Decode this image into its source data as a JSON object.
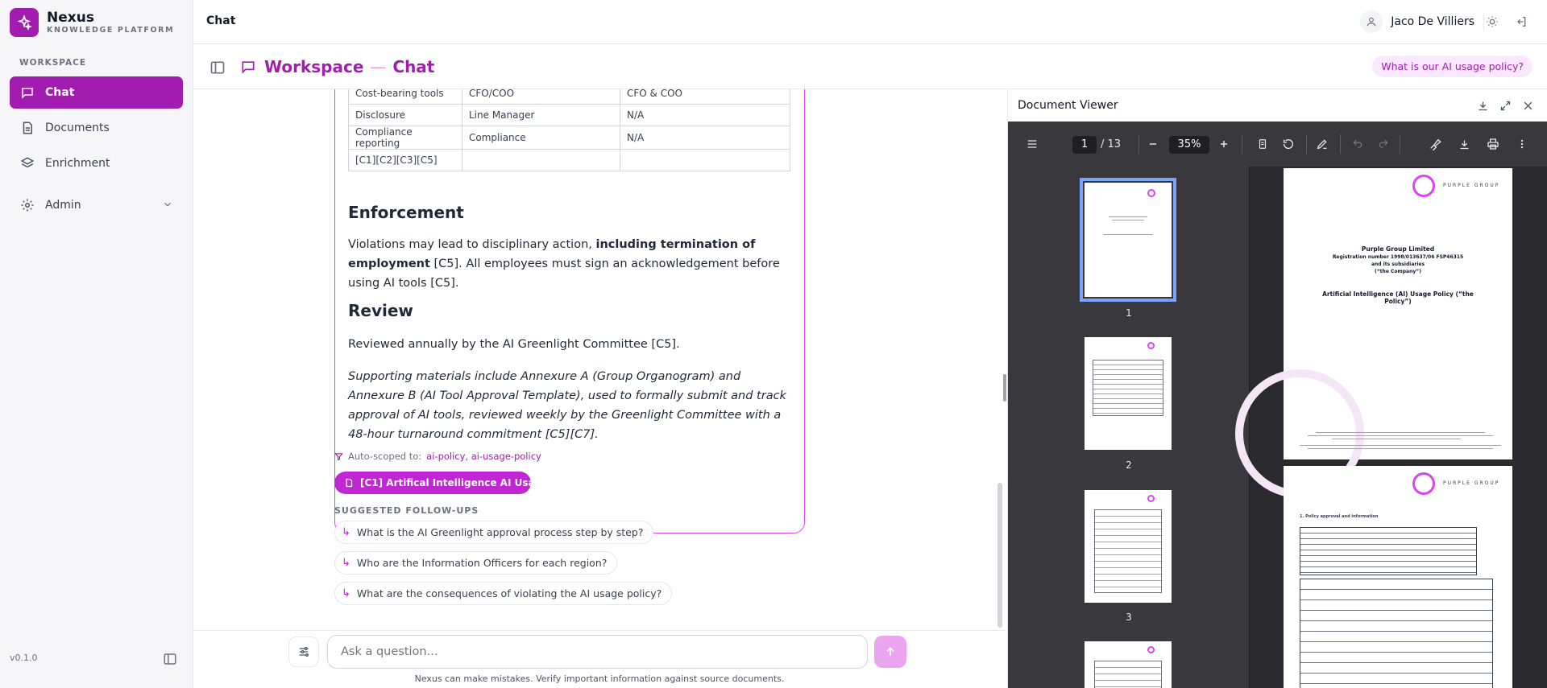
{
  "brand": {
    "name": "Nexus",
    "subtitle": "KNOWLEDGE PLATFORM"
  },
  "sidebar": {
    "section": "WORKSPACE",
    "items": [
      {
        "label": "Chat",
        "icon": "chat-icon",
        "active": true
      },
      {
        "label": "Documents",
        "icon": "document-icon"
      },
      {
        "label": "Enrichment",
        "icon": "layers-icon"
      },
      {
        "label": "Admin",
        "icon": "gear-icon"
      }
    ],
    "version": "v0.1.0"
  },
  "topbar": {
    "title": "Chat",
    "user_name": "Jaco De Villiers"
  },
  "subheader": {
    "workspace": "Workspace",
    "separator": "—",
    "chat": "Chat",
    "suggested_question": "What is our AI usage policy?"
  },
  "answer": {
    "table_rows": [
      [
        "Cost-bearing tools",
        "CFO/COO",
        "CFO & COO"
      ],
      [
        "Disclosure",
        "Line Manager",
        "N/A"
      ],
      [
        "Compliance reporting",
        "Compliance",
        "N/A"
      ],
      [
        "[C1][C2][C3][C5]",
        "",
        ""
      ]
    ],
    "enforcement_heading": "Enforcement",
    "enforcement_pre": "Violations may lead to disciplinary action, ",
    "enforcement_bold": "including termination of employment",
    "enforcement_post": "[C5]. All employees must sign an acknowledgement before using AI tools [C5].",
    "review_heading": "Review",
    "review_text": "Reviewed annually by the AI Greenlight Committee [C5].",
    "supporting_text": "Supporting materials include Annexure A (Group Organogram) and Annexure B (AI Tool Approval Template), used to formally submit and track approval of AI tools, reviewed weekly by the Greenlight Committee with a 48-hour turnaround commitment [C5][C7]."
  },
  "scope": {
    "label": "Auto-scoped to:",
    "tags": "ai-policy, ai-usage-policy"
  },
  "source_chip": "[C1] Artifical Intelligence AI Usa...",
  "followups": {
    "label": "SUGGESTED FOLLOW-UPS",
    "items": [
      "What is the AI Greenlight approval process step by step?",
      "Who are the Information Officers for each region?",
      "What are the consequences of violating the AI usage policy?"
    ]
  },
  "composer": {
    "placeholder": "Ask a question...",
    "disclaimer": "Nexus can make mistakes. Verify important information against source documents."
  },
  "viewer": {
    "title": "Document Viewer",
    "page": "1",
    "page_total": "/ 13",
    "zoom": "35%",
    "thumb_labels": [
      "1",
      "2",
      "3"
    ],
    "page1": {
      "brand": "PURPLE GROUP",
      "company": "Purple Group Limited",
      "registration": "Registration number 1998/013637/06 FSP46315",
      "subsidiaries": "and its subsidiaries",
      "the_company": "(“the Company”)",
      "policy_title": "Artificial Intelligence (AI) Usage Policy (“the Policy”)"
    },
    "page2": {
      "brand": "PURPLE GROUP",
      "heading": "1.   Policy approval and information"
    }
  },
  "colors": {
    "accent": "#a21caf",
    "accent_light": "#fae8ff",
    "toolbar": "#38383d"
  }
}
